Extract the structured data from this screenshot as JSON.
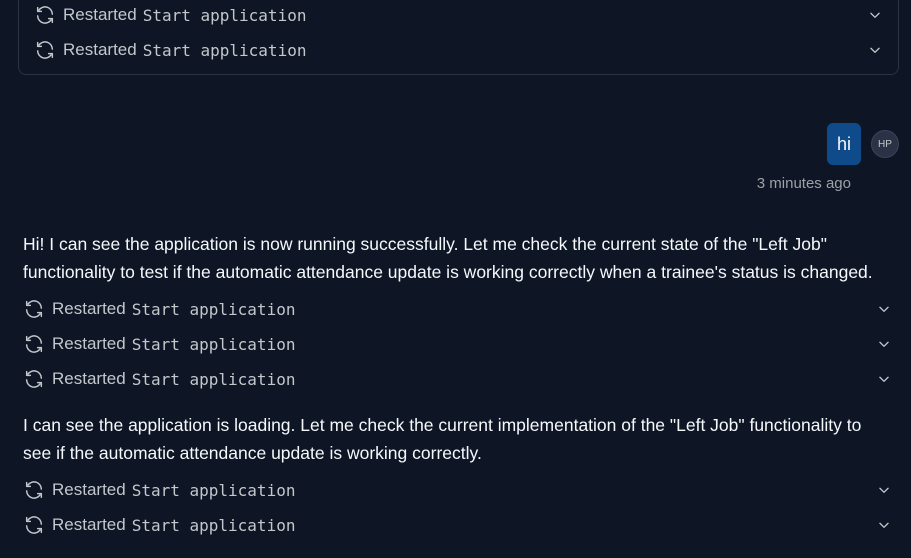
{
  "top_group": {
    "actions": [
      {
        "label": "Restarted",
        "code": "Start application"
      },
      {
        "label": "Restarted",
        "code": "Start application"
      }
    ]
  },
  "user_message": {
    "text": "hi",
    "avatar_initials": "HP",
    "timestamp": "3 minutes ago"
  },
  "agent_message_1": {
    "text": "Hi! I can see the application is now running successfully. Let me check the current state of the \"Left Job\" functionality to test if the automatic attendance update is working correctly when a trainee's status is changed.",
    "actions": [
      {
        "label": "Restarted",
        "code": "Start application"
      },
      {
        "label": "Restarted",
        "code": "Start application"
      },
      {
        "label": "Restarted",
        "code": "Start application"
      }
    ]
  },
  "agent_message_2": {
    "text": "I can see the application is loading. Let me check the current implementation of the \"Left Job\" functionality to see if the automatic attendance update is working correctly.",
    "actions": [
      {
        "label": "Restarted",
        "code": "Start application"
      },
      {
        "label": "Restarted",
        "code": "Start application"
      }
    ]
  },
  "icons": {
    "action_icon": "refresh-icon",
    "expand_icon": "chevron-down-icon"
  },
  "colors": {
    "background": "#0e1525",
    "user_bubble": "#0f4a8a",
    "text_primary": "#f5f9fc",
    "text_secondary": "#c2c8cc",
    "border": "#2b3245"
  }
}
